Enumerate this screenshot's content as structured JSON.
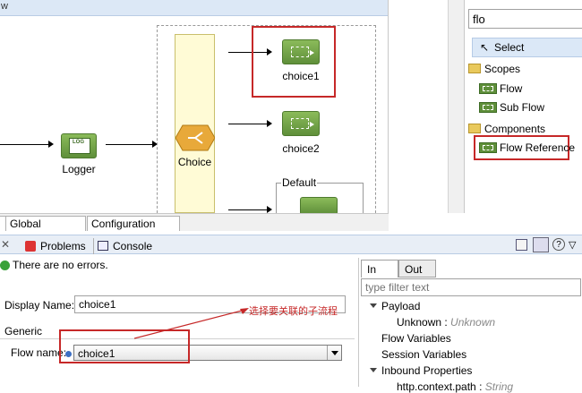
{
  "canvas": {
    "header_text": "w",
    "nodes": {
      "logger": "Logger",
      "choice": "Choice",
      "choice1": "choice1",
      "choice2": "choice2",
      "default": "Default"
    }
  },
  "canvas_tabs": [
    "Global Elements",
    "Configuration XML"
  ],
  "palette": {
    "search_value": "flo",
    "select_label": "Select",
    "groups": [
      {
        "label": "Scopes",
        "items": [
          "Flow",
          "Sub Flow"
        ]
      },
      {
        "label": "Components",
        "items": [
          "Flow Reference"
        ]
      }
    ]
  },
  "bottom_tabs": [
    "Problems",
    "Console"
  ],
  "status": "There are no errors.",
  "props": {
    "display_name_label": "Display Name:",
    "display_name_value": "choice1",
    "annotation": "选择要关联的子流程",
    "section_title": "Generic",
    "flow_name_label": "Flow name:",
    "flow_name_value": "choice1"
  },
  "inout": {
    "tabs": [
      "In",
      "Out"
    ],
    "filter_placeholder": "type filter text",
    "tree": {
      "payload": "Payload",
      "unknown_key": "Unknown :",
      "unknown_type": "Unknown",
      "flow_variables": "Flow Variables",
      "session_variables": "Session Variables",
      "inbound_properties": "Inbound Properties",
      "http_context_path": "http.context.path :",
      "http_context_type": "String"
    }
  },
  "colors": {
    "highlight": "#c62828",
    "annotation": "#c62828",
    "node_green": "#5f8f3a",
    "choice_fill": "#fffbd6"
  }
}
